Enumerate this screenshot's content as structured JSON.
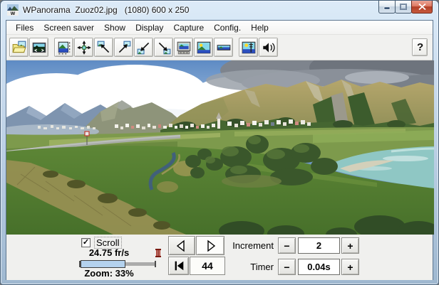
{
  "window": {
    "title": "WPanorama  Zuoz02.jpg   (1080) 600 x 250",
    "icon_letter": "w",
    "controls": [
      "minimize-button",
      "maximize-button",
      "close-button"
    ]
  },
  "menu": {
    "items": [
      "Files",
      "Screen saver",
      "Show",
      "Display",
      "Capture",
      "Config.",
      "Help"
    ]
  },
  "toolbar": {
    "buttons": [
      "open-panorama",
      "show-panorama",
      "fit-window",
      "center-panorama",
      "scroll-left-top",
      "scroll-right-top",
      "scroll-left-bottom",
      "scroll-right-bottom",
      "preview-screen",
      "full-screen",
      "banner-mode",
      "screen-saver",
      "sound"
    ],
    "help_label": "?"
  },
  "panel": {
    "scroll_label": "Scroll",
    "scroll_checked": true,
    "check_glyph": "✓",
    "framerate": "24.75 fr/s",
    "zoom_text": "Zoom: 33%",
    "slider_fill_pct": 58,
    "nav_icons": [
      "prev-frame",
      "next-frame",
      "first-frame"
    ],
    "frame_counter": "44",
    "increment": {
      "label": "Increment",
      "minus": "−",
      "value": "2",
      "plus": "+"
    },
    "timer": {
      "label": "Timer",
      "minus": "−",
      "value": "0.04s",
      "plus": "+"
    }
  }
}
